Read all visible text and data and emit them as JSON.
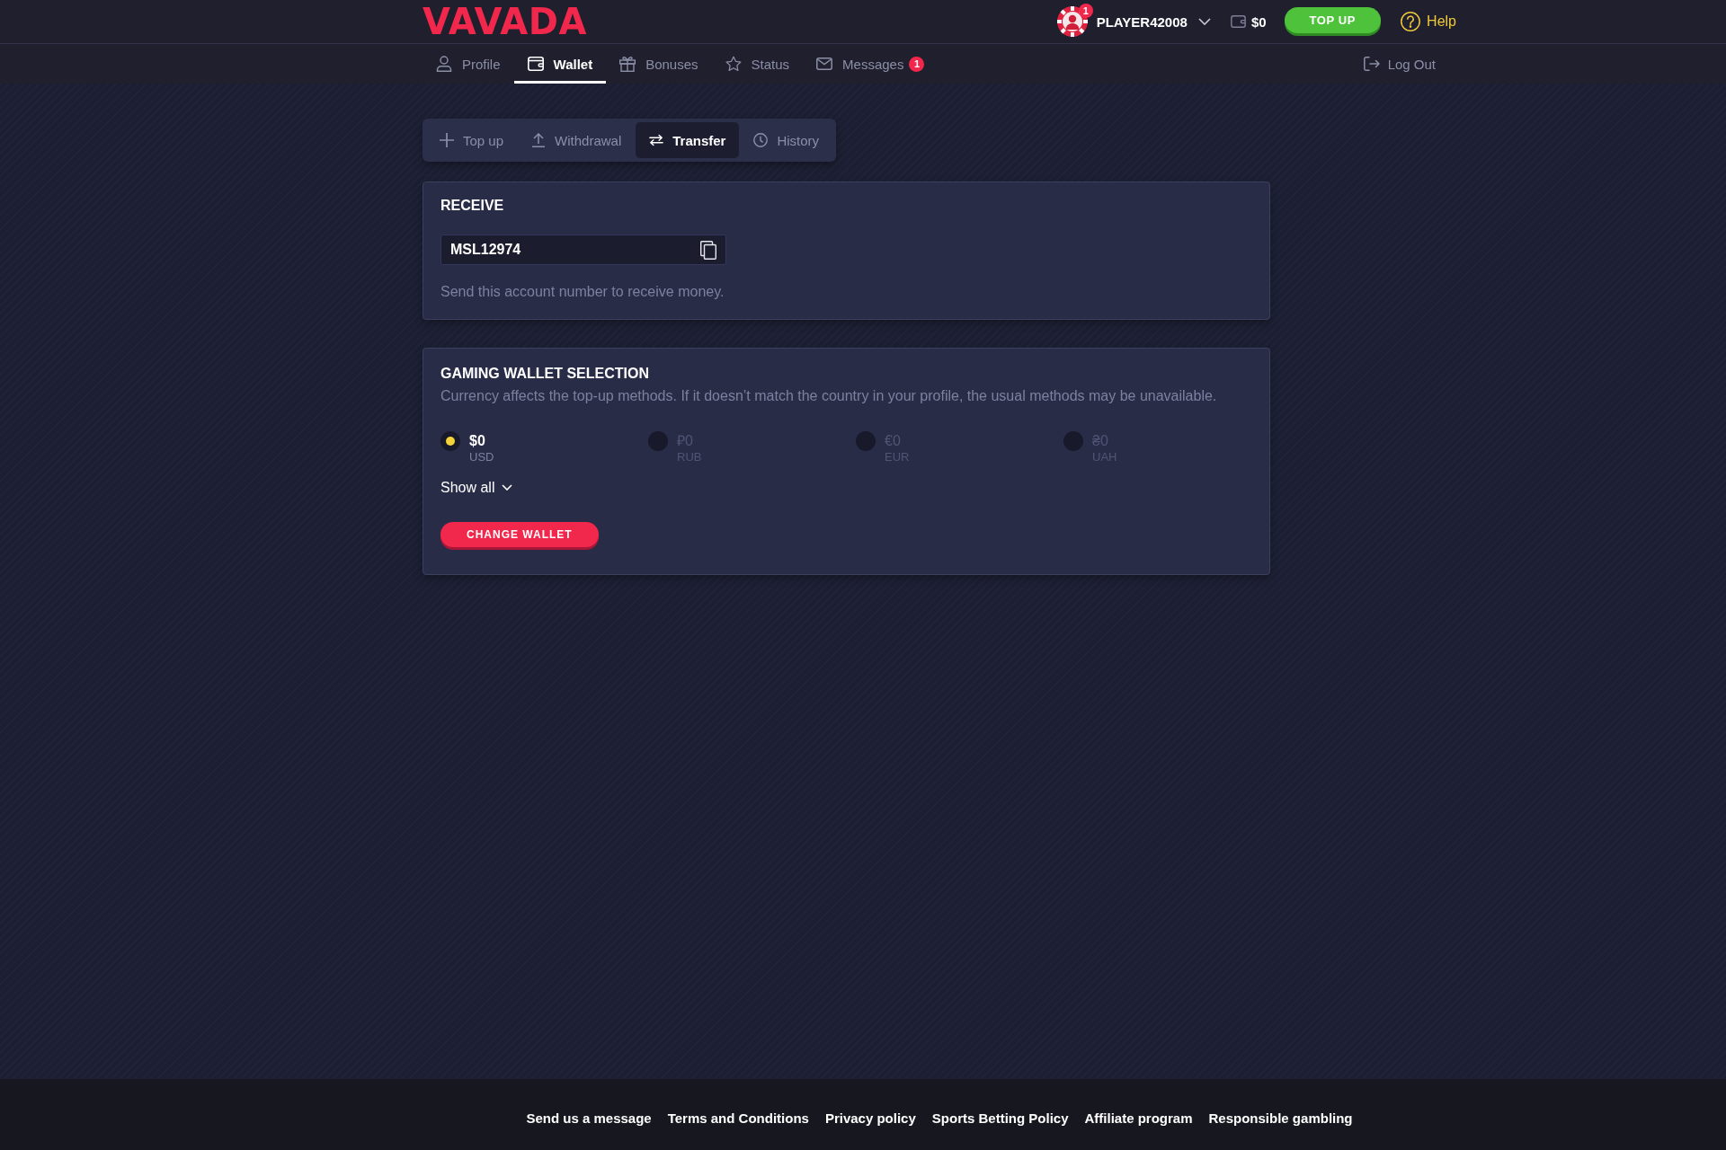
{
  "header": {
    "logo": "VAVADA",
    "user": {
      "name": "PLAYER42008",
      "badge": "1"
    },
    "balance": "$0",
    "top_up_button": "TOP UP",
    "help_link": "Help"
  },
  "nav": {
    "tabs": [
      {
        "label": "Profile",
        "selected": false
      },
      {
        "label": "Wallet",
        "selected": true
      },
      {
        "label": "Bonuses",
        "selected": false
      },
      {
        "label": "Status",
        "selected": false
      },
      {
        "label": "Messages",
        "selected": false,
        "badge": "1"
      }
    ],
    "logout": "Log Out"
  },
  "wallet_tabs": [
    {
      "label": "Top up",
      "selected": false
    },
    {
      "label": "Withdrawal",
      "selected": false
    },
    {
      "label": "Transfer",
      "selected": true
    },
    {
      "label": "History",
      "selected": false
    }
  ],
  "receive": {
    "title": "RECEIVE",
    "account_field": {
      "value": "MSL12974"
    },
    "hint": "Send this account number to receive money."
  },
  "wallet_selection": {
    "title": "GAMING WALLET SELECTION",
    "description": "Currency affects the top-up methods. If it doesn’t match the country in your profile, the usual methods may be unavailable.",
    "currencies": [
      {
        "amount": "$0",
        "code": "USD",
        "selected": true
      },
      {
        "amount": "₽0",
        "code": "RUB",
        "selected": false
      },
      {
        "amount": "€0",
        "code": "EUR",
        "selected": false
      },
      {
        "amount": "₴0",
        "code": "UAH",
        "selected": false
      }
    ],
    "show_all": "Show all",
    "change_button": "CHANGE WALLET"
  },
  "footer": {
    "links": [
      "Send us a message",
      "Terms and Conditions",
      "Privacy policy",
      "Sports Betting Policy",
      "Affiliate program",
      "Responsible gambling"
    ]
  }
}
